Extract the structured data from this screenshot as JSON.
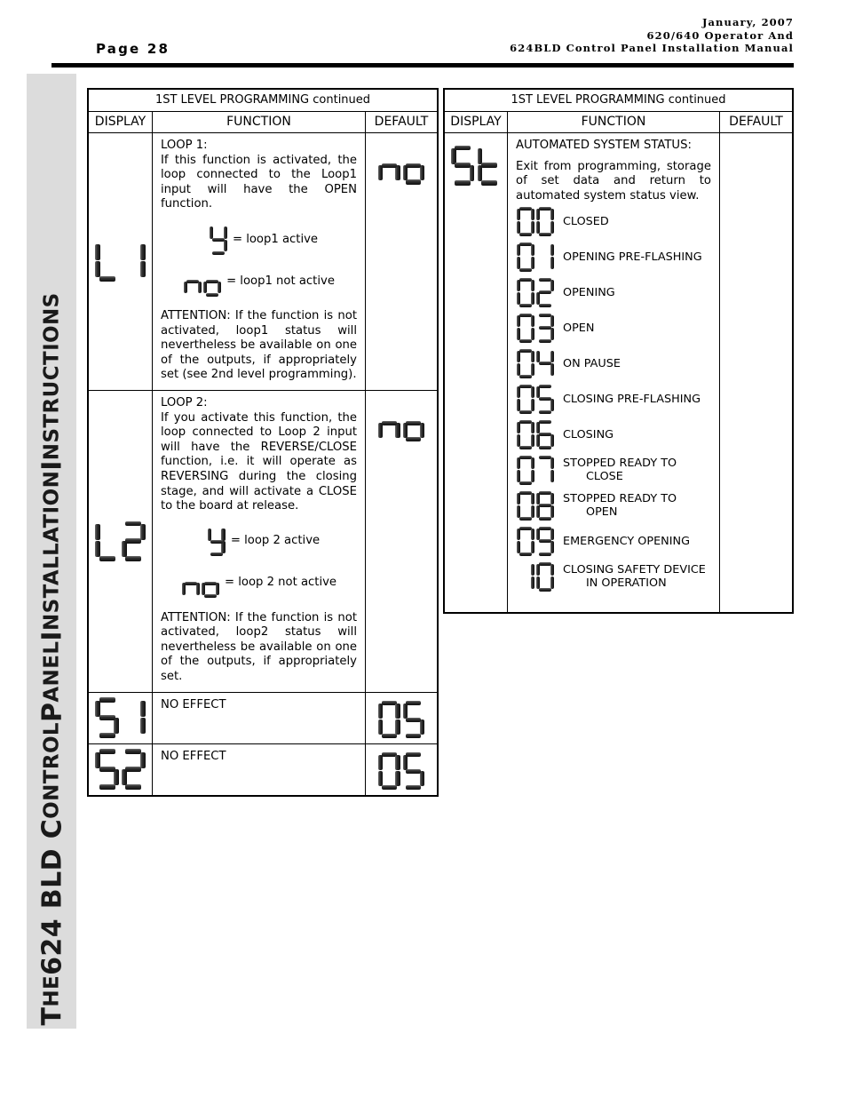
{
  "header": {
    "page_label": "Page 28",
    "date": "January, 2007",
    "line2": "620/640 Operator And",
    "line3": "624BLD Control Panel Installation Manual"
  },
  "sidebar": {
    "text": "THE 624 BLD CONTROL PANEL INSTALLATION INSTRUCTIONS",
    "parts": [
      {
        "t": "T",
        "caps": false
      },
      {
        "t": "HE ",
        "caps": true
      },
      {
        "t": "624 BLD C",
        "caps": false
      },
      {
        "t": "ONTROL ",
        "caps": true
      },
      {
        "t": "P",
        "caps": false
      },
      {
        "t": "ANEL ",
        "caps": true
      },
      {
        "t": "I",
        "caps": false
      },
      {
        "t": "NSTALLATION ",
        "caps": true
      },
      {
        "t": "I",
        "caps": false
      },
      {
        "t": "NSTRUCTIONS",
        "caps": true
      }
    ]
  },
  "table_title": "1ST LEVEL PROGRAMMING continued",
  "columns": {
    "display": "DISPLAY",
    "function": "FUNCTION",
    "default": "DEFAULT"
  },
  "left_table": {
    "rows": [
      {
        "display_code": "L1",
        "default_code": "no",
        "heading": "LOOP 1:",
        "body": "If this function is activated, the loop connected to the Loop1 input will have the OPEN function.",
        "options": [
          {
            "code": "y",
            "label": "= loop1 active"
          },
          {
            "code": "no",
            "label": "= loop1 not active"
          }
        ],
        "attention": "ATTENTION:  If the function is not activated, loop1 status will nevertheless be available on one of the outputs, if appropriately set (see 2nd level programming)."
      },
      {
        "display_code": "L2",
        "default_code": "no",
        "heading": "LOOP 2:",
        "body": "If you activate this function, the loop connected to Loop 2 input will have the REVERSE/CLOSE function, i.e. it will operate as REVERSING during the closing stage, and will activate a  CLOSE to the board at release.",
        "options": [
          {
            "code": "y",
            "label": "= loop 2 active"
          },
          {
            "code": "no",
            "label": "= loop 2 not active"
          }
        ],
        "attention": "ATTENTION:  If the function is not activated, loop2 status will nevertheless be available on one of the outputs, if appropriately set."
      },
      {
        "display_code": "S1",
        "default_code": "05",
        "body": "NO EFFECT"
      },
      {
        "display_code": "S2",
        "default_code": "05",
        "body": "NO EFFECT"
      }
    ]
  },
  "right_table": {
    "display_code": "St",
    "default_code": "",
    "heading": "AUTOMATED SYSTEM STATUS:",
    "body": "Exit from programming, storage of set data and return to automated system status view.",
    "statuses": [
      {
        "code": "00",
        "label": "CLOSED",
        "label2": ""
      },
      {
        "code": "01",
        "label": "OPENING PRE-FLASHING",
        "label2": ""
      },
      {
        "code": "02",
        "label": "OPENING",
        "label2": ""
      },
      {
        "code": "03",
        "label": "OPEN",
        "label2": ""
      },
      {
        "code": "04",
        "label": "ON PAUSE",
        "label2": ""
      },
      {
        "code": "05",
        "label": "CLOSING PRE-FLASHING",
        "label2": ""
      },
      {
        "code": "06",
        "label": "CLOSING",
        "label2": ""
      },
      {
        "code": "07",
        "label": "STOPPED READY TO",
        "label2": "CLOSE"
      },
      {
        "code": "08",
        "label": "STOPPED READY TO",
        "label2": "OPEN"
      },
      {
        "code": "09",
        "label": "EMERGENCY OPENING",
        "label2": ""
      },
      {
        "code": "10",
        "label": "CLOSING SAFETY DEVICE",
        "label2": "IN OPERATION"
      }
    ]
  },
  "colors": {
    "sidebar_band": "#dcdcdc",
    "rule": "#000000",
    "segment_dark": "#101010",
    "segment_light": "#6e6e6e"
  }
}
